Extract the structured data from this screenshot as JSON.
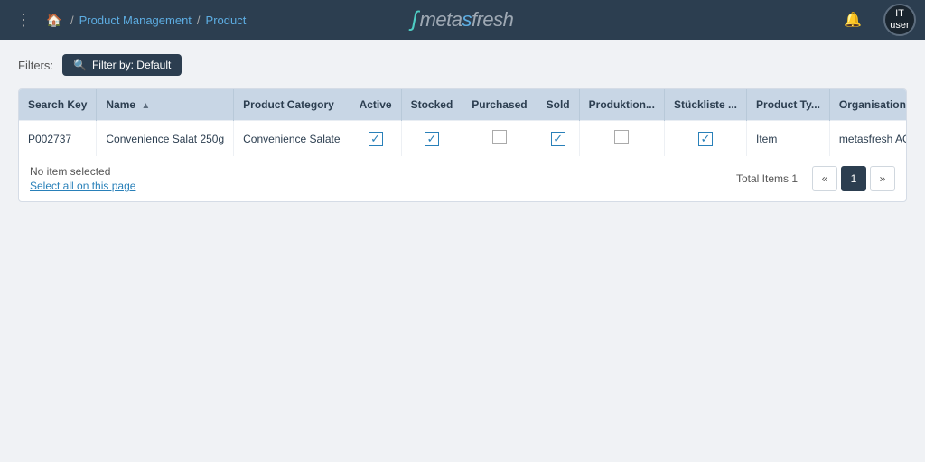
{
  "app": {
    "title": "metasfresh",
    "logo_text": "metasfresh"
  },
  "topnav": {
    "dots_icon": "⋮",
    "home_icon": "⌂",
    "breadcrumb": [
      {
        "label": "Product Management",
        "href": "#"
      },
      {
        "label": "Product",
        "href": "#"
      }
    ],
    "bell_icon": "🔔",
    "avatar": {
      "initials": "IT\nuser"
    }
  },
  "filters": {
    "label": "Filters:",
    "active_filter": "Filter by: Default",
    "filter_icon": "🔍"
  },
  "table": {
    "columns": [
      {
        "key": "search_key",
        "label": "Search Key",
        "sortable": false
      },
      {
        "key": "name",
        "label": "Name",
        "sortable": true,
        "sort_direction": "asc"
      },
      {
        "key": "product_category",
        "label": "Product Category",
        "sortable": false
      },
      {
        "key": "active",
        "label": "Active",
        "sortable": false
      },
      {
        "key": "stocked",
        "label": "Stocked",
        "sortable": false
      },
      {
        "key": "purchased",
        "label": "Purchased",
        "sortable": false
      },
      {
        "key": "sold",
        "label": "Sold",
        "sortable": false
      },
      {
        "key": "produktion",
        "label": "Produktion...",
        "sortable": false
      },
      {
        "key": "stuckliste",
        "label": "Stückliste ...",
        "sortable": false
      },
      {
        "key": "product_type",
        "label": "Product Ty...",
        "sortable": false
      },
      {
        "key": "organisation",
        "label": "Organisation",
        "sortable": false
      }
    ],
    "rows": [
      {
        "search_key": "P002737",
        "name": "Convenience Salat 250g",
        "product_category": "Convenience Salate",
        "active": true,
        "stocked": true,
        "purchased": false,
        "sold": true,
        "produktion": false,
        "stuckliste": true,
        "product_type": "Item",
        "organisation": "metasfresh AG"
      }
    ]
  },
  "footer": {
    "no_item_selected": "No item selected",
    "select_all_label": "Select all on this page",
    "total_label": "Total Items 1",
    "pagination": {
      "prev_icon": "«",
      "next_icon": "»",
      "current_page": "1"
    }
  }
}
